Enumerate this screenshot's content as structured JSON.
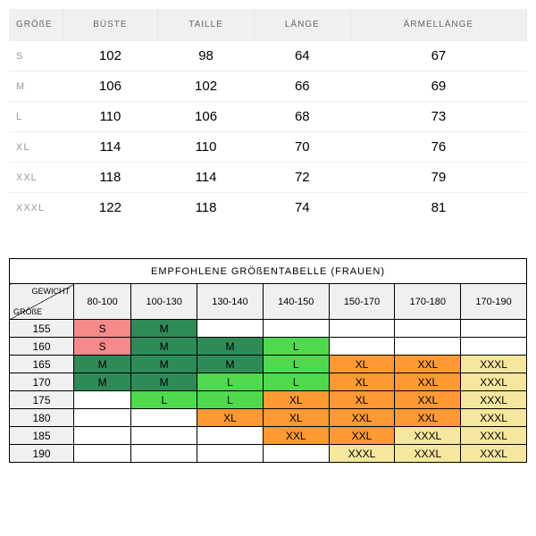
{
  "size_table": {
    "headers": [
      "GRÖßE",
      "BÜSTE",
      "TAILLE",
      "LÄNGE",
      "ÄRMELLÄNGE"
    ],
    "rows": [
      [
        "S",
        "102",
        "98",
        "64",
        "67"
      ],
      [
        "M",
        "106",
        "102",
        "66",
        "69"
      ],
      [
        "L",
        "110",
        "106",
        "68",
        "73"
      ],
      [
        "XL",
        "114",
        "110",
        "70",
        "76"
      ],
      [
        "XXL",
        "118",
        "114",
        "72",
        "79"
      ],
      [
        "XXXL",
        "122",
        "118",
        "74",
        "81"
      ]
    ]
  },
  "rec_table": {
    "title": "EMPFOHLENE GRÖßENTABELLE (FRAUEN)",
    "diag_top": "GEWICHT",
    "diag_bot": "GRÖßE",
    "weight_headers": [
      "80-100",
      "100-130",
      "130-140",
      "140-150",
      "150-170",
      "170-180",
      "170-190"
    ],
    "height_headers": [
      "155",
      "160",
      "165",
      "170",
      "175",
      "180",
      "185",
      "190"
    ],
    "cells": [
      [
        [
          "S",
          "pink"
        ],
        [
          "M",
          "dgreen"
        ],
        [
          "",
          ""
        ],
        [
          "",
          ""
        ],
        [
          "",
          ""
        ],
        [
          "",
          ""
        ],
        [
          "",
          ""
        ]
      ],
      [
        [
          "S",
          "pink"
        ],
        [
          "M",
          "dgreen"
        ],
        [
          "M",
          "dgreen"
        ],
        [
          "L",
          "lgreen"
        ],
        [
          "",
          ""
        ],
        [
          "",
          ""
        ],
        [
          "",
          ""
        ]
      ],
      [
        [
          "M",
          "dgreen"
        ],
        [
          "M",
          "dgreen"
        ],
        [
          "M",
          "dgreen"
        ],
        [
          "L",
          "lgreen"
        ],
        [
          "XL",
          "orange"
        ],
        [
          "XXL",
          "orange"
        ],
        [
          "XXXL",
          "yellow"
        ]
      ],
      [
        [
          "M",
          "dgreen"
        ],
        [
          "M",
          "dgreen"
        ],
        [
          "L",
          "lgreen"
        ],
        [
          "L",
          "lgreen"
        ],
        [
          "XL",
          "orange"
        ],
        [
          "XXL",
          "orange"
        ],
        [
          "XXXL",
          "yellow"
        ]
      ],
      [
        [
          "",
          ""
        ],
        [
          "L",
          "lgreen"
        ],
        [
          "L",
          "lgreen"
        ],
        [
          "XL",
          "orange"
        ],
        [
          "XL",
          "orange"
        ],
        [
          "XXL",
          "orange"
        ],
        [
          "XXXL",
          "yellow"
        ]
      ],
      [
        [
          "",
          ""
        ],
        [
          "",
          ""
        ],
        [
          "XL",
          "orange"
        ],
        [
          "XL",
          "orange"
        ],
        [
          "XXL",
          "orange"
        ],
        [
          "XXL",
          "orange"
        ],
        [
          "XXXL",
          "yellow"
        ]
      ],
      [
        [
          "",
          ""
        ],
        [
          "",
          ""
        ],
        [
          "",
          ""
        ],
        [
          "XXL",
          "orange"
        ],
        [
          "XXL",
          "orange"
        ],
        [
          "XXXL",
          "yellow"
        ],
        [
          "XXXL",
          "yellow"
        ]
      ],
      [
        [
          "",
          ""
        ],
        [
          "",
          ""
        ],
        [
          "",
          ""
        ],
        [
          "",
          ""
        ],
        [
          "XXXL",
          "yellow"
        ],
        [
          "XXXL",
          "yellow"
        ],
        [
          "XXXL",
          "yellow"
        ]
      ]
    ]
  },
  "chart_data": [
    {
      "type": "table",
      "title": "Größentabelle",
      "columns": [
        "GRÖßE",
        "BÜSTE",
        "TAILLE",
        "LÄNGE",
        "ÄRMELLÄNGE"
      ],
      "rows": [
        [
          "S",
          102,
          98,
          64,
          67
        ],
        [
          "M",
          106,
          102,
          66,
          69
        ],
        [
          "L",
          110,
          106,
          68,
          73
        ],
        [
          "XL",
          114,
          110,
          70,
          76
        ],
        [
          "XXL",
          118,
          114,
          72,
          79
        ],
        [
          "XXXL",
          122,
          118,
          74,
          81
        ]
      ]
    },
    {
      "type": "heatmap",
      "title": "EMPFOHLENE GRÖßENTABELLE (FRAUEN)",
      "xlabel": "GEWICHT",
      "ylabel": "GRÖßE",
      "x": [
        "80-100",
        "100-130",
        "130-140",
        "140-150",
        "150-170",
        "170-180",
        "170-190"
      ],
      "y": [
        "155",
        "160",
        "165",
        "170",
        "175",
        "180",
        "185",
        "190"
      ],
      "values": [
        [
          "S",
          "M",
          "",
          "",
          "",
          "",
          ""
        ],
        [
          "S",
          "M",
          "M",
          "L",
          "",
          "",
          ""
        ],
        [
          "M",
          "M",
          "M",
          "L",
          "XL",
          "XXL",
          "XXXL"
        ],
        [
          "M",
          "M",
          "L",
          "L",
          "XL",
          "XXL",
          "XXXL"
        ],
        [
          "",
          "L",
          "L",
          "XL",
          "XL",
          "XXL",
          "XXXL"
        ],
        [
          "",
          "",
          "XL",
          "XL",
          "XXL",
          "XXL",
          "XXXL"
        ],
        [
          "",
          "",
          "",
          "XXL",
          "XXL",
          "XXXL",
          "XXXL"
        ],
        [
          "",
          "",
          "",
          "",
          "XXXL",
          "XXXL",
          "XXXL"
        ]
      ]
    }
  ]
}
